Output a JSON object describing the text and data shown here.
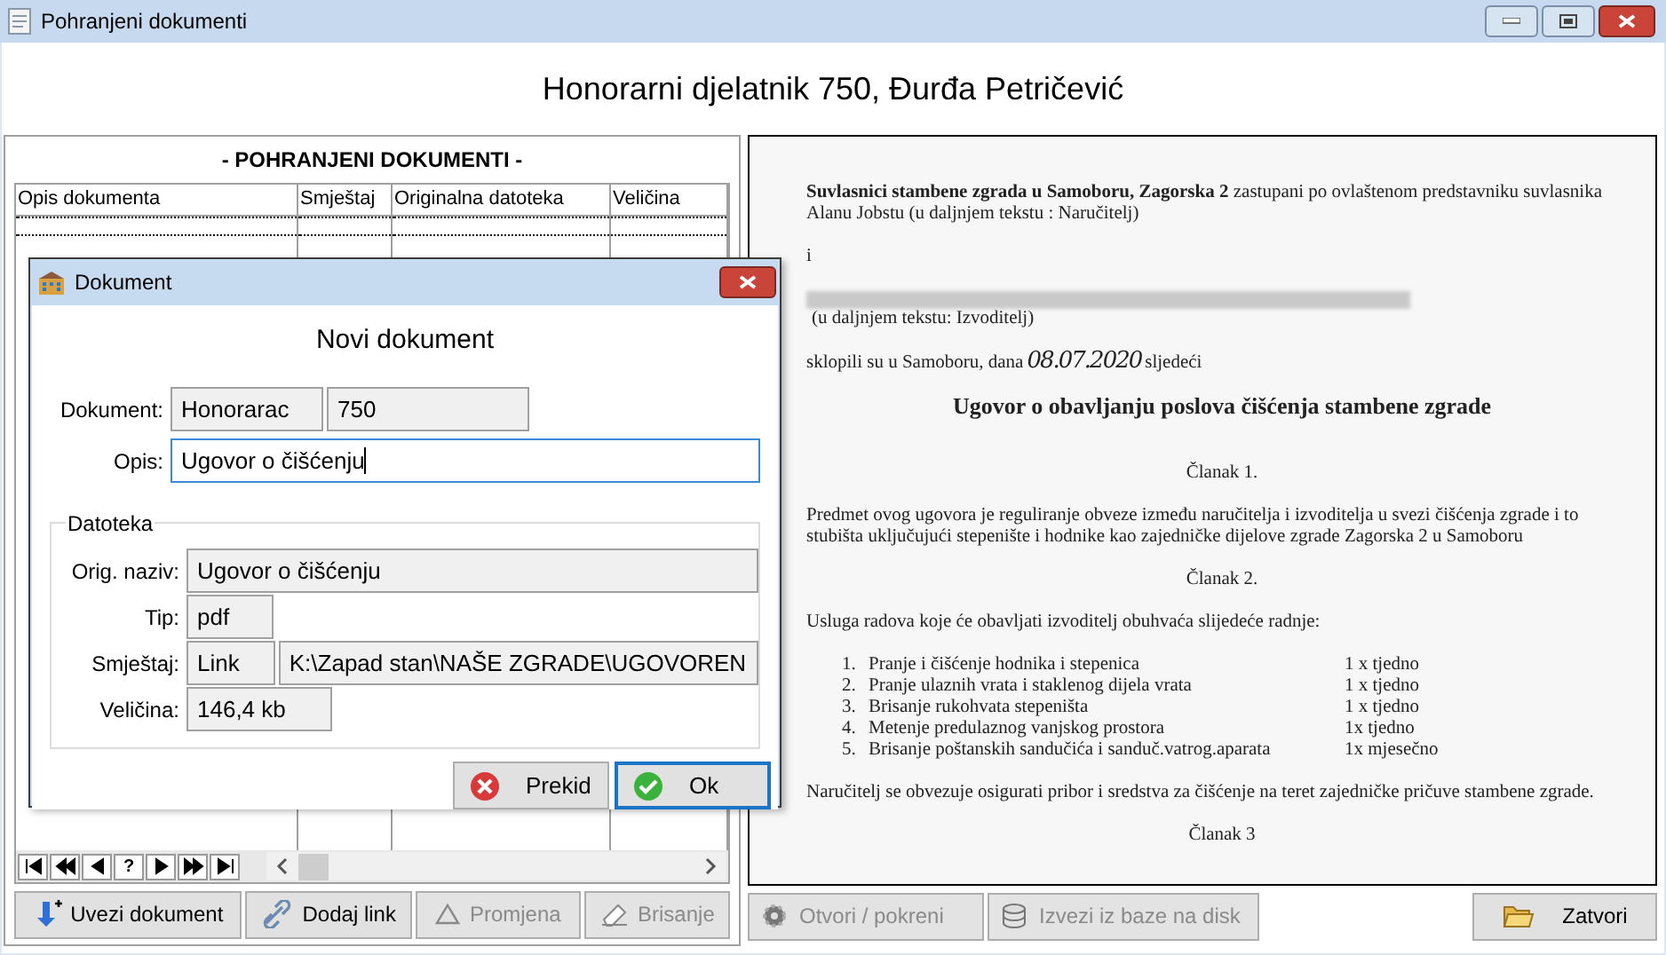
{
  "window": {
    "title": "Pohranjeni dokumenti"
  },
  "header": "Honorarni djelatnik 750, Đurđa Petričević",
  "documents_panel": {
    "title": "- POHRANJENI DOKUMENTI -",
    "columns": [
      "Opis dokumenta",
      "Smještaj",
      "Originalna datoteka",
      "Veličina"
    ],
    "nav_help": "?"
  },
  "left_buttons": [
    {
      "label": "Uvezi dokument",
      "disabled": false
    },
    {
      "label": "Dodaj link",
      "disabled": false
    },
    {
      "label": "Promjena",
      "disabled": true
    },
    {
      "label": "Brisanje",
      "disabled": true
    }
  ],
  "preview": {
    "blocks": [
      {
        "kind": "para",
        "text": "**Suvlasnici stambene zgrada u Samoboru, Zagorska 2** zastupani po ovlaštenom predstavniku suvlasnika Alanu Jobstu (u daljnjem tekstu : Naručitelj)"
      },
      {
        "kind": "para",
        "text": "i"
      },
      {
        "kind": "redacted",
        "text": "(u daljnjem tekstu: Izvoditelj)"
      },
      {
        "kind": "dated",
        "text": "sklopili su u Samoboru, dana",
        "date": "08.07.2020",
        "after": "sljedeći"
      },
      {
        "kind": "title",
        "text": "Ugovor o obavljanju poslova čišćenja stambene zgrade"
      },
      {
        "kind": "center",
        "text": "Članak 1."
      },
      {
        "kind": "para",
        "text": "Predmet ovog ugovora je reguliranje obveze između naručitelja i izvoditelja u svezi čišćenja zgrade i to stubišta uključujući stepenište i hodnike kao zajedničke dijelove zgrade Zagorska 2 u Samoboru"
      },
      {
        "kind": "center",
        "text": "Članak 2."
      },
      {
        "kind": "para",
        "text": "Usluga radova koje će obavljati izvoditelj obuhvaća slijedeće radnje:"
      },
      {
        "kind": "list",
        "items": [
          {
            "num": "1.",
            "task": "Pranje i čišćenje hodnika i stepenica",
            "freq": "1 x tjedno"
          },
          {
            "num": "2.",
            "task": "Pranje ulaznih vrata i staklenog dijela vrata",
            "freq": "1 x tjedno"
          },
          {
            "num": "3.",
            "task": "Brisanje rukohvata stepeništa",
            "freq": "1 x tjedno"
          },
          {
            "num": "4.",
            "task": "Metenje predulaznog vanjskog prostora",
            "freq": "1x tjedno"
          },
          {
            "num": "5.",
            "task": "Brisanje poštanskih sandučića i sanduč.vatrog.aparata",
            "freq": "1x mjesečno"
          }
        ]
      },
      {
        "kind": "para",
        "text": "Naručitelj se obvezuje osigurati pribor i sredstva za čišćenje na teret zajedničke pričuve stambene zgrade."
      },
      {
        "kind": "center",
        "text": "Članak 3"
      }
    ]
  },
  "right_buttons": [
    {
      "label": "Otvori / pokreni",
      "disabled": true
    },
    {
      "label": "Izvezi iz baze na disk",
      "disabled": true
    },
    {
      "label": "Zatvori",
      "disabled": false
    }
  ],
  "dialog": {
    "title": "Dokument",
    "heading": "Novi dokument",
    "document_label": "Dokument:",
    "document_type": "Honorarac",
    "document_number": "750",
    "description_label": "Opis:",
    "description": "Ugovor o čišćenju",
    "group_title": "Datoteka",
    "orig_name_label": "Orig. naziv:",
    "orig_name": "Ugovor o čišćenju",
    "type_label": "Tip:",
    "type": "pdf",
    "location_label": "Smještaj:",
    "location_kind": "Link",
    "location_path": "K:\\Zapad stan\\NAŠE ZGRADE\\UGOVOREN",
    "size_label": "Veličina:",
    "size": "146,4 kb",
    "buttons": [
      {
        "label": "Prekid",
        "focused": false
      },
      {
        "label": "Ok",
        "focused": true
      }
    ]
  }
}
